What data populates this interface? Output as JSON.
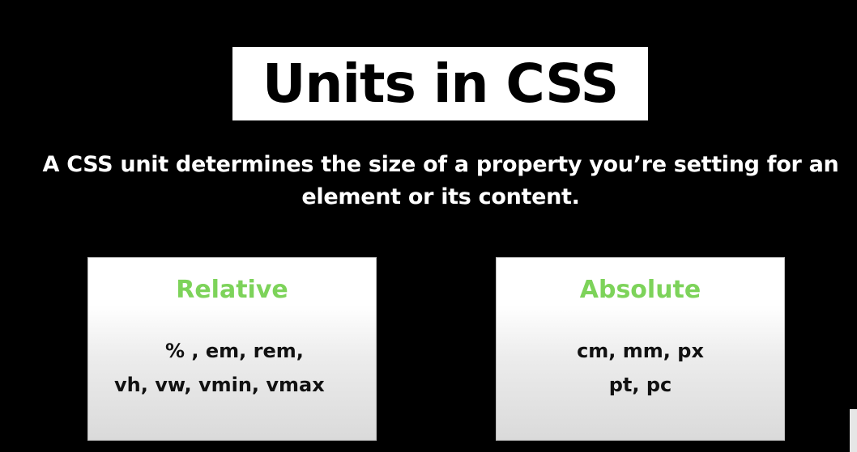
{
  "title": "Units in CSS",
  "description": {
    "line1": "A CSS unit determines the size of a property you’re setting for an",
    "line2": "element or its content."
  },
  "cards": {
    "relative": {
      "heading": "Relative",
      "line1": "% , em, rem,",
      "line2": "vh, vw, vmin, vmax"
    },
    "absolute": {
      "heading": "Absolute",
      "line1": "cm, mm, px",
      "line2": "pt, pc"
    }
  },
  "colors": {
    "background": "#000000",
    "heading_accent": "#7dd35a",
    "title_box": "#ffffff"
  }
}
